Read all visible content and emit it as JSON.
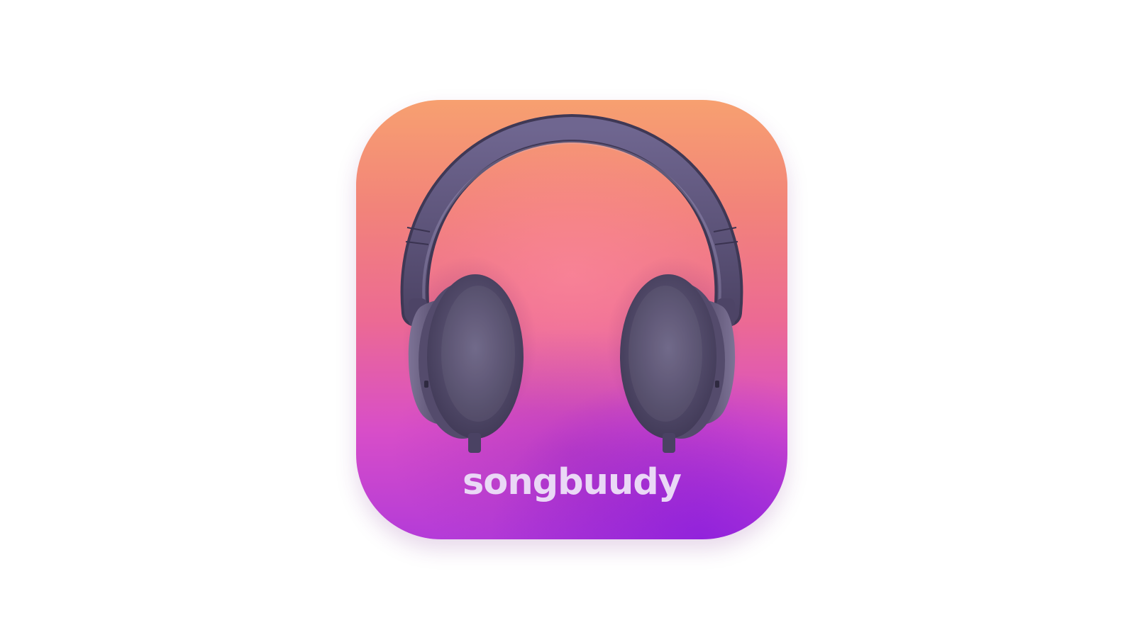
{
  "app_icon": {
    "brand_name": "songbuudy",
    "icon": "headphones-icon",
    "colors": {
      "gradient_top": "#f7a070",
      "gradient_middle": "#ec6a93",
      "gradient_bottom": "#b43bd8",
      "headphones": "#5e5475",
      "wordmark": "#ead8f6",
      "background": "#ffffff"
    }
  }
}
